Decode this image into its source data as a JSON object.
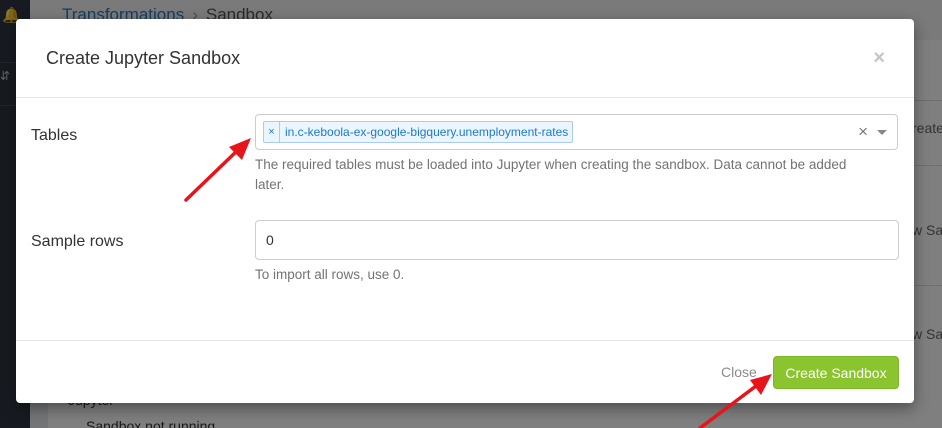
{
  "background": {
    "breadcrumb": {
      "parent": "Transformations",
      "separator": "›",
      "current": "Sandbox"
    },
    "right_peek": [
      "reate",
      "w Sa",
      "w Sa"
    ],
    "bottom_text": {
      "line1": "Jupyter",
      "line2": "Sandbox not running"
    }
  },
  "modal": {
    "title": "Create Jupyter Sandbox",
    "close_icon": "×",
    "tables": {
      "label": "Tables",
      "selected": [
        "in.c-keboola-ex-google-bigquery.unemployment-rates"
      ],
      "tag_remove_icon": "×",
      "clear_icon": "×",
      "help": "The required tables must be loaded into Jupyter when creating the sandbox. Data cannot be added later."
    },
    "sample_rows": {
      "label": "Sample rows",
      "value": "0",
      "help": "To import all rows, use 0."
    },
    "footer": {
      "close_label": "Close",
      "create_label": "Create Sandbox"
    }
  },
  "colors": {
    "accent_green": "#8ac42e",
    "link_blue": "#2a7ac6",
    "arrow_red": "#e8141b"
  },
  "icons": {
    "sidebar_top": "bell-icon",
    "sidebar_mid": "chevron-updown-icon"
  }
}
